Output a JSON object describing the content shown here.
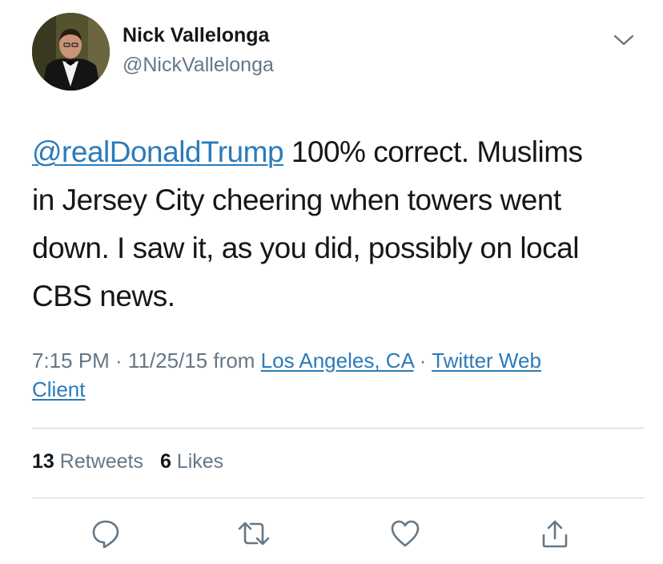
{
  "user": {
    "name": "Nick Vallelonga",
    "handle": "@NickVallelonga"
  },
  "tweet": {
    "mention": "@realDonaldTrump",
    "line1_rest": " 100% correct.  Muslims",
    "line2": "in Jersey City cheering when towers went",
    "line3": "down. I saw it, as you did, possibly on local",
    "line4": "CBS news."
  },
  "meta": {
    "timestamp": "7:15 PM · 11/25/15 from ",
    "location": "Los Angeles, CA",
    "separator": " · ",
    "source_part1": "Twitter Web",
    "source_part2": "Client"
  },
  "stats": {
    "retweets_count": "13",
    "retweets_label": "Retweets",
    "likes_count": "6",
    "likes_label": "Likes"
  },
  "colors": {
    "link": "#2b7bb9",
    "muted": "#657786",
    "text": "#14171a",
    "divider": "#ccd6dd"
  },
  "icons": {
    "menu": "chevron-down-icon",
    "reply": "reply-icon",
    "retweet": "retweet-icon",
    "like": "heart-icon",
    "share": "share-icon"
  }
}
